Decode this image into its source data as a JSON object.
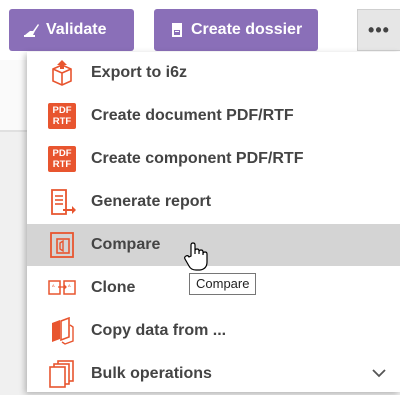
{
  "toolbar": {
    "validate_label": "Validate",
    "create_dossier_label": "Create dossier",
    "more_label": "•••"
  },
  "menu": {
    "items": [
      {
        "label": "Export to i6z",
        "icon": "export-box-icon"
      },
      {
        "label": "Create document PDF/RTF",
        "icon": "pdf-rtf-icon",
        "badge_top": "PDF",
        "badge_bottom": "RTF"
      },
      {
        "label": "Create component PDF/RTF",
        "icon": "pdf-rtf-icon",
        "badge_top": "PDF",
        "badge_bottom": "RTF"
      },
      {
        "label": "Generate report",
        "icon": "report-icon"
      },
      {
        "label": "Compare",
        "icon": "compare-icon",
        "state": "hovered"
      },
      {
        "label": "Clone",
        "icon": "clone-icon"
      },
      {
        "label": "Copy data from ...",
        "icon": "copy-data-icon"
      },
      {
        "label": "Bulk operations",
        "icon": "bulk-operations-icon",
        "expandable": true
      }
    ]
  },
  "tooltip": {
    "text": "Compare"
  },
  "colors": {
    "accent": "#8a6fb8",
    "icon_orange": "#e8552f",
    "hover": "#d4d4d4"
  }
}
